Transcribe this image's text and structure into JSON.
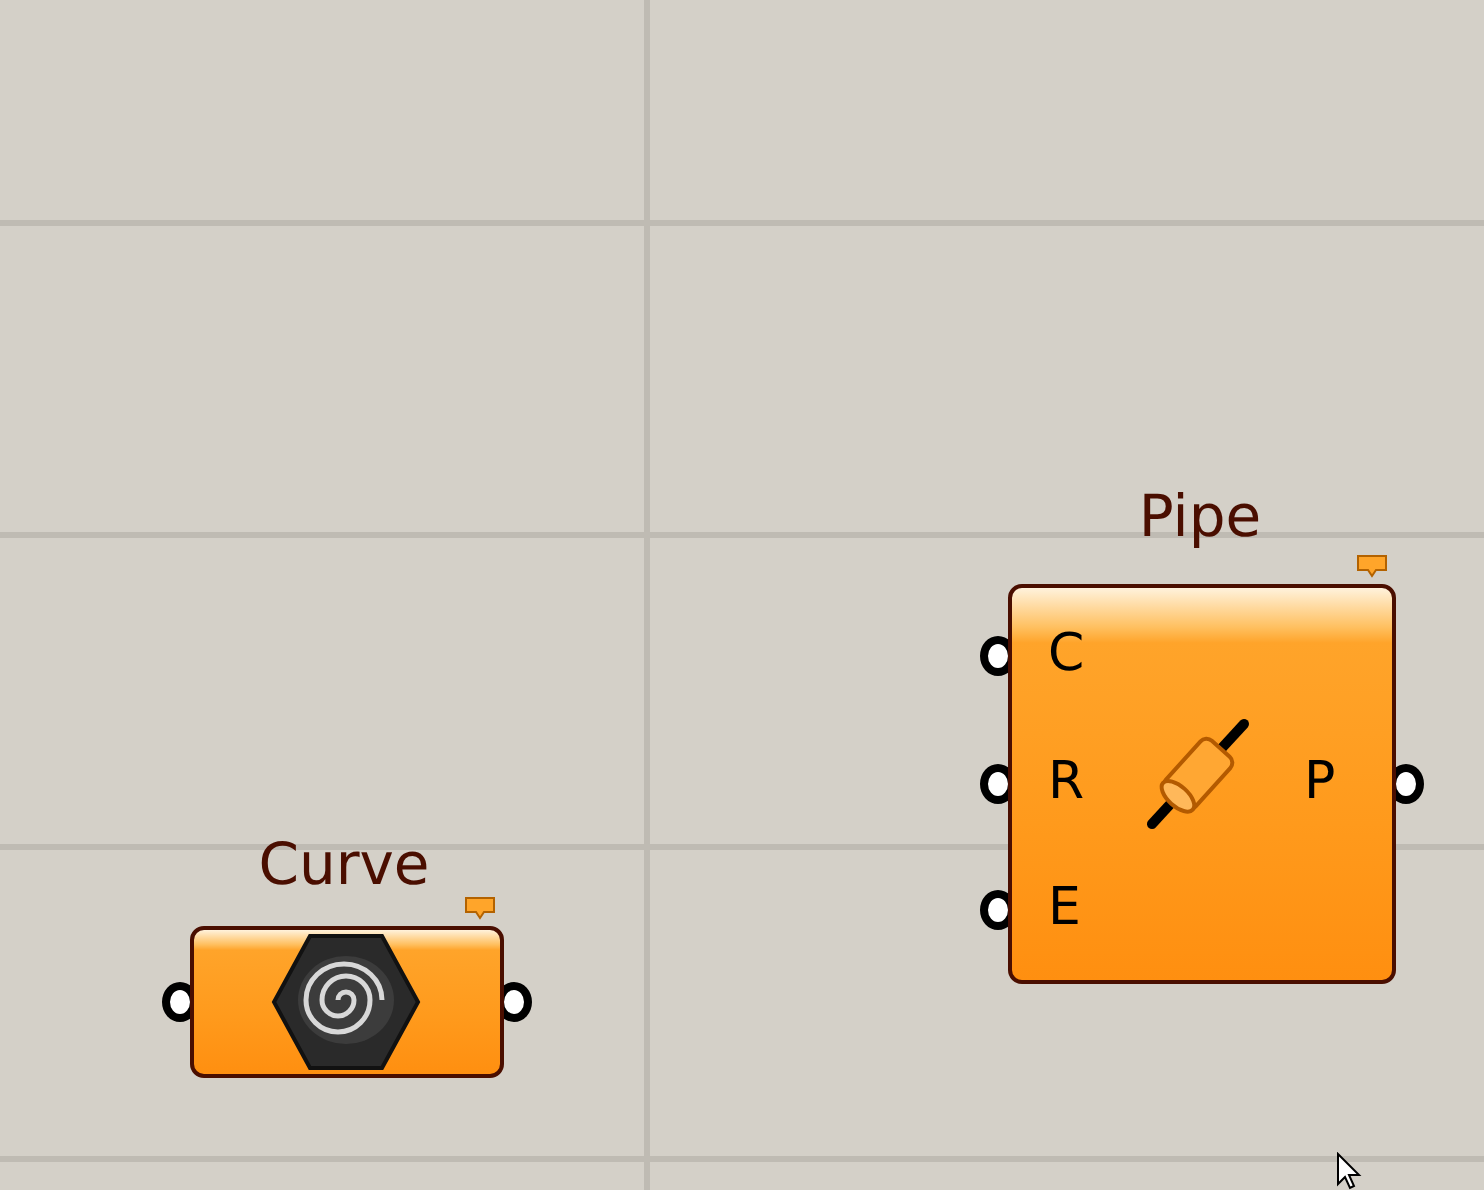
{
  "canvas": {
    "nodes": [
      {
        "kind": "parameter",
        "title": "Curve"
      },
      {
        "kind": "component",
        "title": "Pipe",
        "inputs": [
          "C",
          "R",
          "E"
        ],
        "outputs": [
          "P"
        ]
      }
    ]
  }
}
